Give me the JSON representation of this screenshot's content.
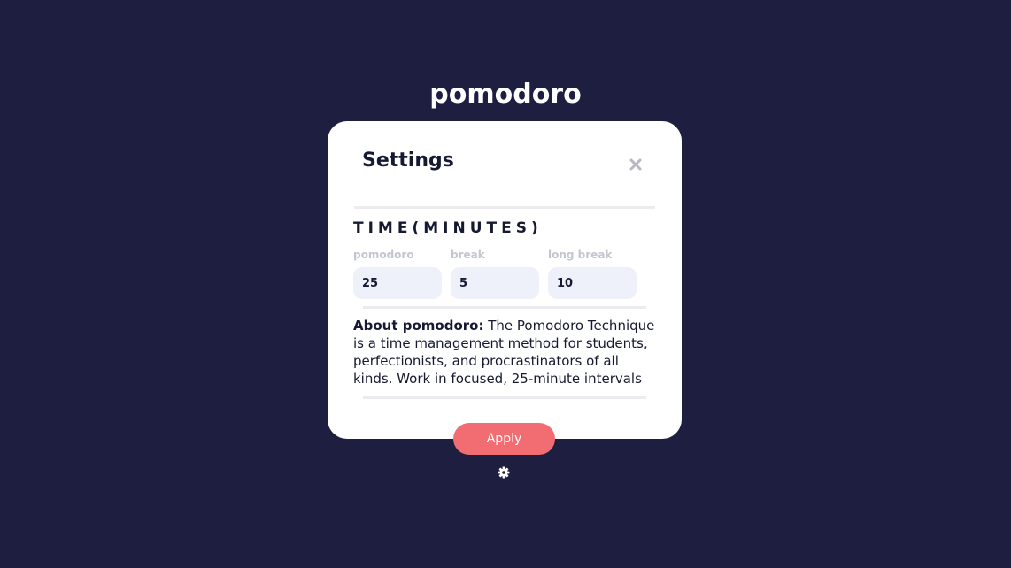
{
  "app": {
    "title": "pomodoro"
  },
  "settings_modal": {
    "title": "Settings",
    "close_icon": "close-icon",
    "time_section": {
      "title": "TIME(MINUTES)",
      "fields": [
        {
          "label": "pomodoro",
          "value": "25"
        },
        {
          "label": "break",
          "value": "5"
        },
        {
          "label": "long break",
          "value": "10"
        }
      ]
    },
    "about": {
      "heading": "About pomodoro:",
      "text": " The Pomodoro Technique is a time management method for students, perfectionists, and procrastinators of all kinds. Work in focused, 25-minute intervals"
    },
    "apply_label": "Apply"
  },
  "footer": {
    "settings_icon": "gear-icon"
  },
  "colors": {
    "background": "#1e1f40",
    "accent": "#f26d72",
    "input_bg": "#eef1fa",
    "label": "#c4c6cf"
  }
}
